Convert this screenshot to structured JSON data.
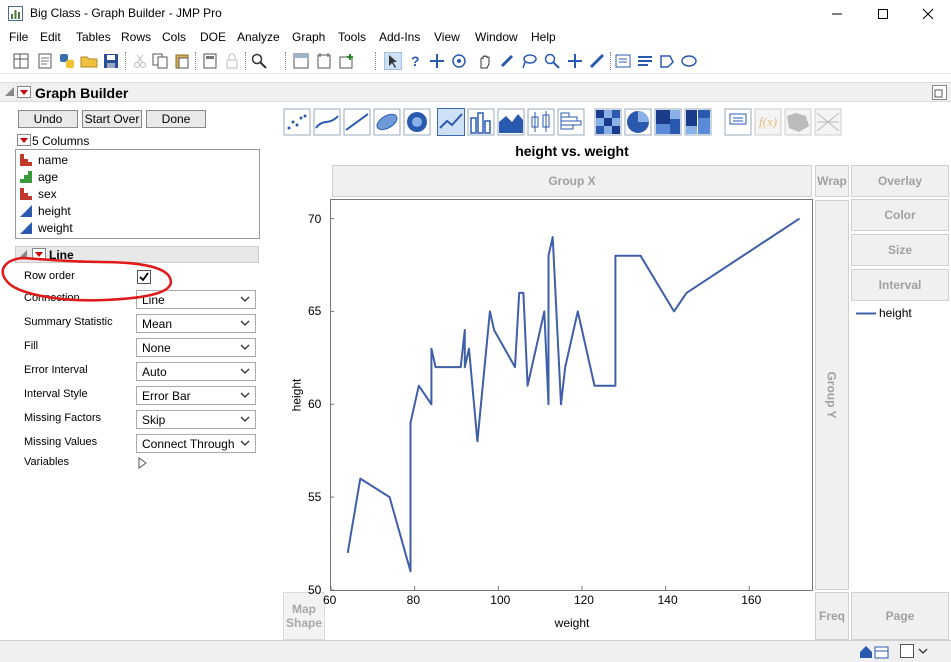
{
  "window": {
    "title": "Big Class - Graph Builder - JMP Pro"
  },
  "menu": [
    "File",
    "Edit",
    "Tables",
    "Rows",
    "Cols",
    "DOE",
    "Analyze",
    "Graph",
    "Tools",
    "Add-Ins",
    "View",
    "Window",
    "Help"
  ],
  "graph_builder": {
    "title": "Graph Builder",
    "buttons": {
      "undo": "Undo",
      "start_over": "Start Over",
      "done": "Done"
    },
    "columns_header": "5 Columns",
    "columns": [
      {
        "name": "name",
        "type": "nominal"
      },
      {
        "name": "age",
        "type": "ordinal"
      },
      {
        "name": "sex",
        "type": "nominal"
      },
      {
        "name": "height",
        "type": "continuous"
      },
      {
        "name": "weight",
        "type": "continuous"
      }
    ],
    "line_section": {
      "title": "Line",
      "row_order_label": "Row order",
      "row_order_checked": true,
      "options": [
        {
          "label": "Connection",
          "value": "Line"
        },
        {
          "label": "Summary Statistic",
          "value": "Mean"
        },
        {
          "label": "Fill",
          "value": "None"
        },
        {
          "label": "Error Interval",
          "value": "Auto"
        },
        {
          "label": "Interval Style",
          "value": "Error Bar"
        },
        {
          "label": "Missing Factors",
          "value": "Skip"
        },
        {
          "label": "Missing Values",
          "value": "Connect Through"
        }
      ],
      "variables_label": "Variables"
    },
    "zones": {
      "group_x": "Group X",
      "wrap": "Wrap",
      "overlay": "Overlay",
      "color": "Color",
      "size": "Size",
      "interval": "Interval",
      "group_y": "Group Y",
      "freq": "Freq",
      "page": "Page",
      "map_shape_line1": "Map",
      "map_shape_line2": "Shape"
    },
    "legend": {
      "item": "height",
      "color": "#3f5fa8"
    }
  },
  "chart_data": {
    "type": "line",
    "title": "height vs. weight",
    "xlabel": "weight",
    "ylabel": "height",
    "xlim": [
      60,
      175
    ],
    "ylim": [
      50,
      71
    ],
    "xticks": [
      60,
      80,
      100,
      120,
      140,
      160
    ],
    "yticks": [
      50,
      55,
      60,
      65,
      70
    ],
    "grid": false,
    "legend_position": "right",
    "series": [
      {
        "name": "height",
        "color": "#3f5fa8",
        "points": [
          [
            64,
            52
          ],
          [
            67,
            56
          ],
          [
            74,
            55
          ],
          [
            79,
            51
          ],
          [
            79,
            59
          ],
          [
            81,
            61
          ],
          [
            84,
            60
          ],
          [
            84,
            63
          ],
          [
            85,
            62
          ],
          [
            91,
            62
          ],
          [
            92,
            64
          ],
          [
            92,
            62
          ],
          [
            93,
            63
          ],
          [
            95,
            58
          ],
          [
            98,
            65
          ],
          [
            99,
            64
          ],
          [
            104,
            62
          ],
          [
            105,
            66
          ],
          [
            106,
            66
          ],
          [
            107,
            61
          ],
          [
            111,
            65
          ],
          [
            112,
            60
          ],
          [
            112,
            68
          ],
          [
            113,
            69
          ],
          [
            115,
            60
          ],
          [
            116,
            62
          ],
          [
            119,
            65
          ],
          [
            123,
            61
          ],
          [
            128,
            61
          ],
          [
            128,
            68
          ],
          [
            134,
            68
          ],
          [
            142,
            65
          ],
          [
            145,
            66
          ],
          [
            172,
            70
          ]
        ]
      }
    ]
  },
  "status": {}
}
